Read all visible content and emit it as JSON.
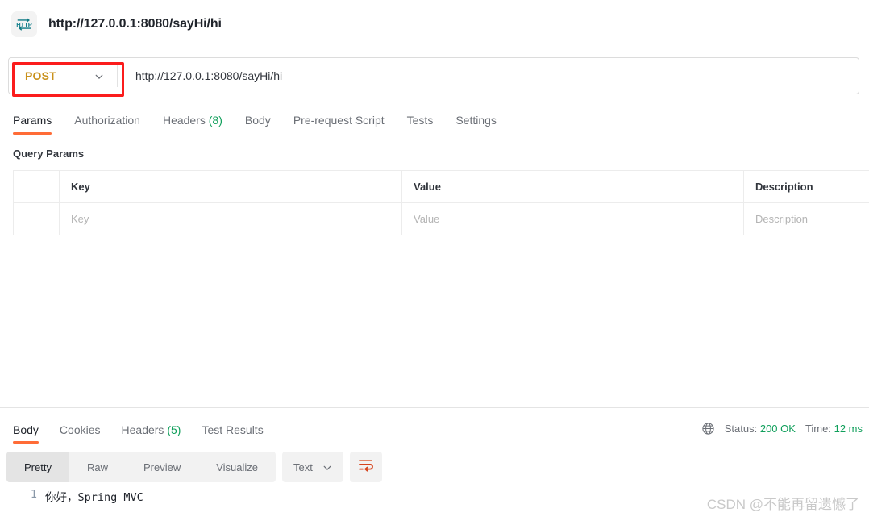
{
  "titlebar": {
    "icon": "http-protocol-icon",
    "request_name": "http://127.0.0.1:8080/sayHi/hi"
  },
  "urlbar": {
    "method": "POST",
    "method_color": "#c9911b",
    "dropdown_icon": "chevron-down-icon",
    "url": "http://127.0.0.1:8080/sayHi/hi",
    "annotation": "red-highlight-box",
    "annotation_color": "#fb1c1c"
  },
  "request_tabs": [
    {
      "label": "Params",
      "count": "",
      "active": true
    },
    {
      "label": "Authorization",
      "count": "",
      "active": false
    },
    {
      "label": "Headers",
      "count": "(8)",
      "active": false
    },
    {
      "label": "Body",
      "count": "",
      "active": false
    },
    {
      "label": "Pre-request Script",
      "count": "",
      "active": false
    },
    {
      "label": "Tests",
      "count": "",
      "active": false
    },
    {
      "label": "Settings",
      "count": "",
      "active": false
    }
  ],
  "query_params": {
    "section_title": "Query Params",
    "headers": {
      "key": "Key",
      "value": "Value",
      "description": "Description"
    },
    "rows": [
      {
        "key": "Key",
        "value": "Value",
        "description": "Description"
      }
    ]
  },
  "response": {
    "tabs": [
      {
        "label": "Body",
        "count": "",
        "active": true
      },
      {
        "label": "Cookies",
        "count": "",
        "active": false
      },
      {
        "label": "Headers",
        "count": "(5)",
        "active": false
      },
      {
        "label": "Test Results",
        "count": "",
        "active": false
      }
    ],
    "globe_icon": "globe-icon",
    "status_label": "Status:",
    "status_value": "200 OK",
    "time_label": "Time:",
    "time_value": "12 ms",
    "status_color": "#109f5b"
  },
  "format_toolbar": {
    "views": [
      {
        "label": "Pretty",
        "active": true
      },
      {
        "label": "Raw",
        "active": false
      },
      {
        "label": "Preview",
        "active": false
      },
      {
        "label": "Visualize",
        "active": false
      }
    ],
    "content_type": "Text",
    "content_type_icon": "chevron-down-icon",
    "wrap_icon": "word-wrap-icon",
    "wrap_icon_color": "#e04a20"
  },
  "body_content": {
    "line_number": "1",
    "text": "你好，Spring MVC"
  },
  "watermark": {
    "text": "CSDN @不能再留遗憾了"
  },
  "accent": {
    "orange": "#ff6c37",
    "green": "#109f5b"
  }
}
